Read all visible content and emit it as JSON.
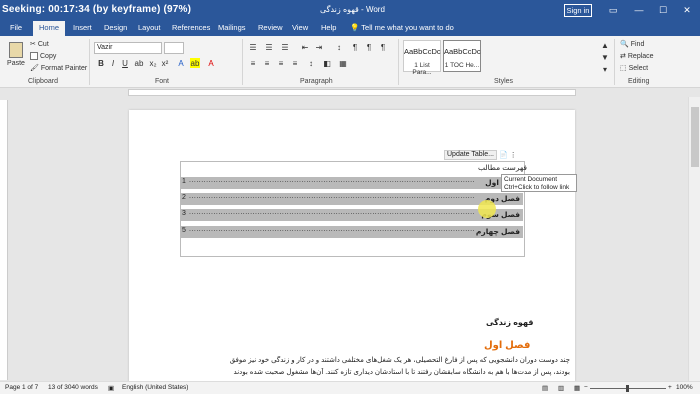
{
  "window": {
    "seeking": "Seeking: 00:17:34 (by keyframe) (97%)",
    "title": "قهوه زندگی - Word",
    "signin": "Sign in"
  },
  "tabs": [
    "File",
    "Home",
    "Insert",
    "Design",
    "Layout",
    "References",
    "Mailings",
    "Review",
    "View",
    "Help"
  ],
  "tellme": "Tell me what you want to do",
  "ribbon": {
    "clipboard": {
      "paste": "Paste",
      "cut": "Cut",
      "copy": "Copy",
      "format_painter": "Format Painter",
      "label": "Clipboard"
    },
    "font": {
      "name": "Vazir",
      "size": "",
      "label": "Font"
    },
    "paragraph": {
      "label": "Paragraph"
    },
    "styles": {
      "label": "Styles",
      "cards": [
        {
          "sample": "AaBbCcDc",
          "name": "1 List Para..."
        },
        {
          "sample": "AaBbCcDc",
          "name": "1 TOC He..."
        }
      ]
    },
    "editing": {
      "find": "Find",
      "replace": "Replace",
      "select": "Select",
      "label": "Editing"
    }
  },
  "document": {
    "toc_toolbar": {
      "update": "Update Table..."
    },
    "toc_heading": "فهرست مطالب",
    "toc_rows": [
      {
        "label": "فصل اول",
        "page": "1"
      },
      {
        "label": "فصل دوم",
        "page": "2"
      },
      {
        "label": "فصل سوم",
        "page": "3"
      },
      {
        "label": "فصل چهارم",
        "page": "5"
      }
    ],
    "tooltip": {
      "line1": "Current Document",
      "line2": "Ctrl+Click to follow link"
    },
    "title": "قهوه زندگی",
    "heading1": "فصل اول",
    "para1": "چند دوست دوران دانشجویی که پس از فارغ التحصیلی، هر یک شغل‌های مختلفی داشتند و در کار و زندگی خود نیز موفق",
    "para2": "بودند، پس از مدت‌ها با هم به دانشگاه سابقشان رفتند تا با استادشان دیداری تازه کنند. آن‌ها مشغول صحبت شده بودند"
  },
  "status": {
    "page": "Page 1 of 7",
    "words": "13 of 3040 words",
    "language": "English (United States)",
    "zoom": "100%"
  }
}
